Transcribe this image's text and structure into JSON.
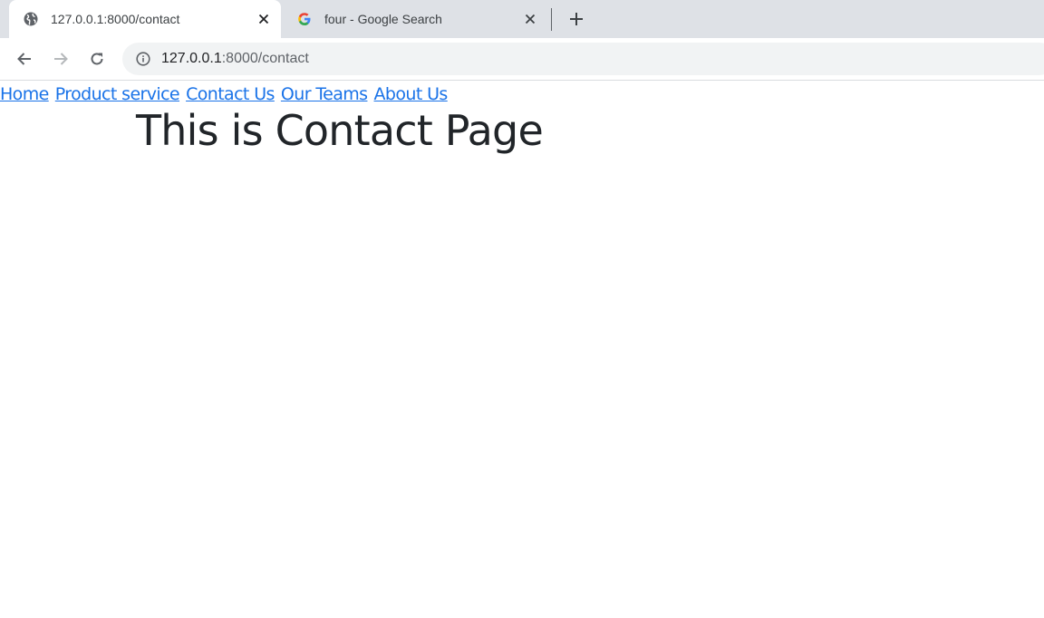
{
  "browser": {
    "tabs": [
      {
        "title": "127.0.0.1:8000/contact",
        "favicon": "globe-icon",
        "active": true
      },
      {
        "title": "four - Google Search",
        "favicon": "google-icon",
        "active": false
      }
    ],
    "address": {
      "host": "127.0.0.1",
      "path": ":8000/contact"
    },
    "colors": {
      "tabstrip": "#dee1e6",
      "omnibox": "#f1f3f4",
      "link": "#1a73e8",
      "heading": "#212529"
    }
  },
  "page": {
    "nav": {
      "home": "Home",
      "product_service": "Product service",
      "contact": "Contact Us",
      "teams": "Our Teams",
      "about": "About Us"
    },
    "heading": "This is Contact Page"
  }
}
